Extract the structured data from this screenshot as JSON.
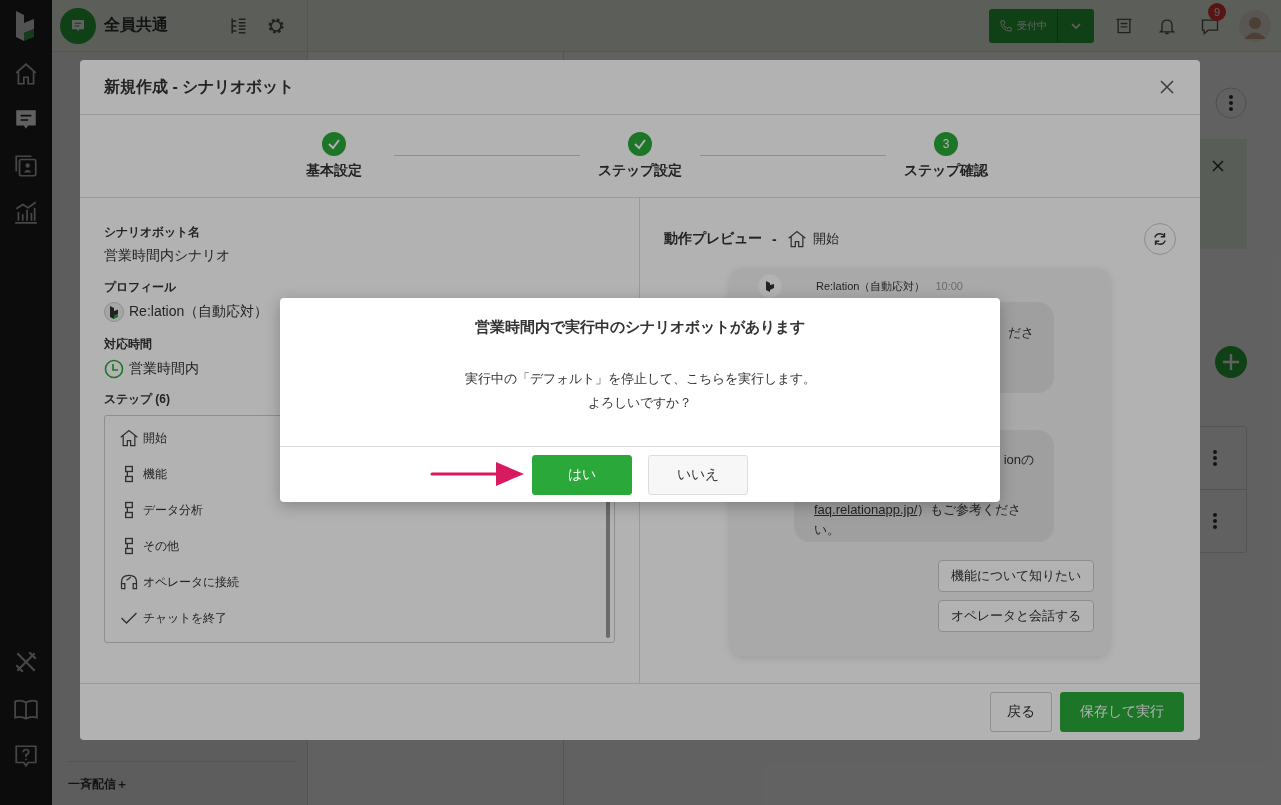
{
  "app": {
    "channel_name": "全員共通",
    "status_button": {
      "label": "受付中"
    },
    "notification_badge": "9",
    "sidebar_footer": "一斉配信＋",
    "rail_items": [
      {
        "kind": "home",
        "selected": false
      },
      {
        "kind": "chat",
        "selected": true
      },
      {
        "kind": "contacts",
        "selected": false
      },
      {
        "kind": "report",
        "selected": false
      }
    ]
  },
  "modal": {
    "title": "新規作成 - シナリオボット",
    "steps": [
      {
        "label": "基本設定",
        "done": true
      },
      {
        "label": "ステップ設定",
        "done": true
      },
      {
        "label": "ステップ確認",
        "done": false,
        "number": "3"
      }
    ],
    "form": {
      "fields": [
        {
          "kind": "text",
          "label": "シナリオボット名",
          "value": "営業時間内シナリオ"
        },
        {
          "kind": "profile",
          "label": "プロフィール",
          "value": "Re:lation（自動応対）"
        },
        {
          "kind": "hours",
          "label": "対応時間",
          "value": "営業時間内"
        }
      ],
      "steps_label": "ステップ (6)",
      "steps": [
        {
          "kind": "start",
          "label": "開始"
        },
        {
          "kind": "branch",
          "label": "機能"
        },
        {
          "kind": "branch",
          "label": "データ分析"
        },
        {
          "kind": "branch",
          "label": "その他"
        },
        {
          "kind": "operator",
          "label": "オペレータに接続"
        },
        {
          "kind": "end",
          "label": "チャットを終了"
        }
      ]
    },
    "preview": {
      "title": "動作プレビュー",
      "separator": "-",
      "current_step": "開始",
      "sender": "Re:lation（自動応対）",
      "time": "10:00",
      "bubbles": [
        {
          "lines": [
            {
              "kind": "tail",
              "text": "ださ"
            }
          ]
        },
        {
          "lines": [
            {
              "kind": "tail",
              "text": "ionの"
            },
            {
              "kind": "full",
              "link": "faq.relationapp.jp/",
              "text": "）もご参考くださ"
            },
            {
              "kind": "full",
              "text": "い。"
            }
          ]
        }
      ],
      "quick_replies": [
        "機能について知りたい",
        "オペレータと会話する"
      ]
    },
    "buttons": [
      {
        "kind": "secondary",
        "label": "戻る"
      },
      {
        "kind": "primary",
        "label": "保存して実行"
      }
    ]
  },
  "dialog": {
    "title": "営業時間内で実行中のシナリオボットがあります",
    "message": [
      "実行中の「デフォルト」を停止して、こちらを実行します。",
      "よろしいですか？"
    ],
    "buttons": [
      {
        "kind": "primary",
        "label": "はい"
      },
      {
        "kind": "secondary",
        "label": "いいえ"
      }
    ]
  }
}
